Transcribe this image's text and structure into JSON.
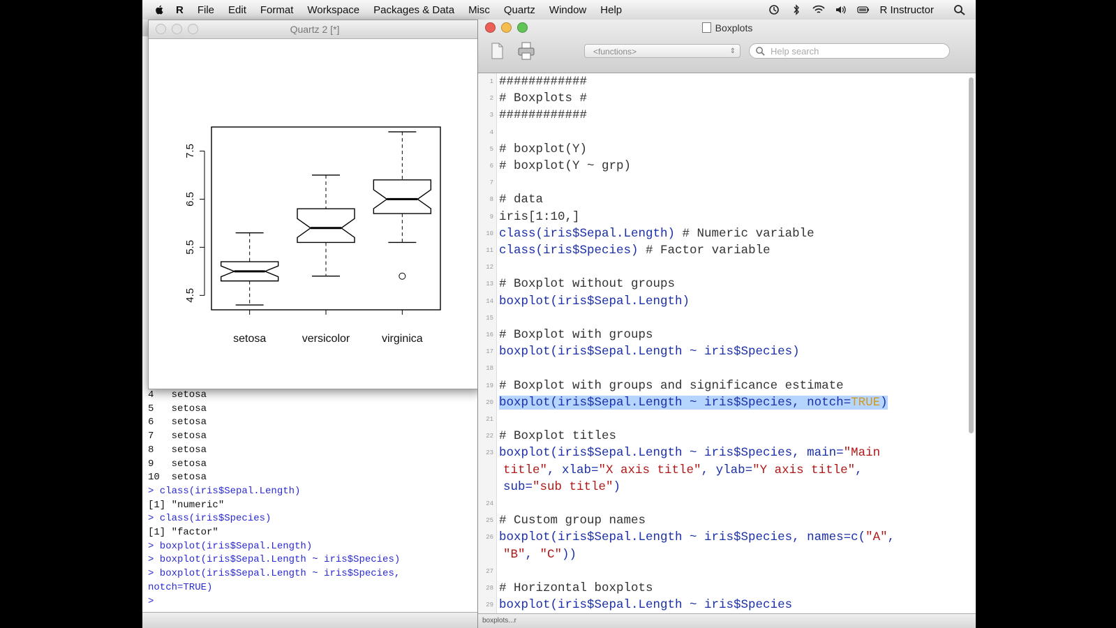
{
  "menubar": {
    "items": [
      "R",
      "File",
      "Edit",
      "Format",
      "Workspace",
      "Packages & Data",
      "Misc",
      "Quartz",
      "Window",
      "Help"
    ],
    "user": "R Instructor",
    "status_icons": [
      "time-machine-icon",
      "bluetooth-icon",
      "wifi-icon",
      "volume-icon",
      "battery-icon"
    ]
  },
  "console": {
    "lines": [
      {
        "text": "4   setosa",
        "type": "out"
      },
      {
        "text": "5   setosa",
        "type": "out"
      },
      {
        "text": "6   setosa",
        "type": "out"
      },
      {
        "text": "7   setosa",
        "type": "out"
      },
      {
        "text": "8   setosa",
        "type": "out"
      },
      {
        "text": "9   setosa",
        "type": "out"
      },
      {
        "text": "10  setosa",
        "type": "out"
      },
      {
        "text": "> class(iris$Sepal.Length)",
        "type": "in"
      },
      {
        "text": "[1] \"numeric\"",
        "type": "out"
      },
      {
        "text": "> class(iris$Species)",
        "type": "in"
      },
      {
        "text": "[1] \"factor\"",
        "type": "out"
      },
      {
        "text": "> boxplot(iris$Sepal.Length)",
        "type": "in"
      },
      {
        "text": "> boxplot(iris$Sepal.Length ~ iris$Species)",
        "type": "in"
      },
      {
        "text": "> boxplot(iris$Sepal.Length ~ iris$Species,",
        "type": "in"
      },
      {
        "text": "notch=TRUE)",
        "type": "in"
      },
      {
        "text": ">",
        "type": "in"
      }
    ]
  },
  "quartz": {
    "title": "Quartz 2 [*]"
  },
  "chart_data": {
    "type": "boxplot",
    "notch": true,
    "categories": [
      "setosa",
      "versicolor",
      "virginica"
    ],
    "boxes": [
      {
        "name": "setosa",
        "whisker_low": 4.3,
        "q1": 4.8,
        "median": 5.0,
        "q3": 5.2,
        "whisker_high": 5.8,
        "outliers": []
      },
      {
        "name": "versicolor",
        "whisker_low": 4.9,
        "q1": 5.6,
        "median": 5.9,
        "q3": 6.3,
        "whisker_high": 7.0,
        "outliers": []
      },
      {
        "name": "virginica",
        "whisker_low": 5.6,
        "q1": 6.2,
        "median": 6.5,
        "q3": 6.9,
        "whisker_high": 7.9,
        "outliers": [
          4.9
        ]
      }
    ],
    "y_ticks": [
      "4.5",
      "5.5",
      "6.5",
      "7.5"
    ],
    "y_tick_values": [
      4.5,
      5.5,
      6.5,
      7.5
    ],
    "ylim": [
      4.2,
      8.0
    ]
  },
  "editor": {
    "title": "Boxplots",
    "functions_placeholder": "<functions>",
    "help_placeholder": "Help search",
    "status": "boxplots...r",
    "lines": [
      {
        "n": "1",
        "parts": [
          {
            "t": "############",
            "c": "cm"
          }
        ]
      },
      {
        "n": "2",
        "parts": [
          {
            "t": "# Boxplots #",
            "c": "cm"
          }
        ]
      },
      {
        "n": "3",
        "parts": [
          {
            "t": "############",
            "c": "cm"
          }
        ]
      },
      {
        "n": "4",
        "parts": []
      },
      {
        "n": "5",
        "parts": [
          {
            "t": "# boxplot(Y)",
            "c": "cm"
          }
        ]
      },
      {
        "n": "6",
        "parts": [
          {
            "t": "# boxplot(Y ~ grp)",
            "c": "cm"
          }
        ]
      },
      {
        "n": "7",
        "parts": []
      },
      {
        "n": "8",
        "parts": [
          {
            "t": "# data",
            "c": "cm"
          }
        ]
      },
      {
        "n": "9",
        "parts": [
          {
            "t": "iris[1:10,]",
            "c": "cm"
          }
        ]
      },
      {
        "n": "10",
        "parts": [
          {
            "t": "class(iris$Sepal.Length)",
            "c": "fn"
          },
          {
            "t": " # Numeric variable",
            "c": "cm"
          }
        ]
      },
      {
        "n": "11",
        "parts": [
          {
            "t": "class(iris$Species)",
            "c": "fn"
          },
          {
            "t": " # Factor variable",
            "c": "cm"
          }
        ]
      },
      {
        "n": "12",
        "parts": []
      },
      {
        "n": "13",
        "parts": [
          {
            "t": "# Boxplot without groups",
            "c": "cm"
          }
        ]
      },
      {
        "n": "14",
        "parts": [
          {
            "t": "boxplot(iris$Sepal.Length)",
            "c": "fn"
          }
        ]
      },
      {
        "n": "15",
        "parts": []
      },
      {
        "n": "16",
        "parts": [
          {
            "t": "# Boxplot with groups",
            "c": "cm"
          }
        ]
      },
      {
        "n": "17",
        "parts": [
          {
            "t": "boxplot(iris$Sepal.Length ~ iris$Species)",
            "c": "fn"
          }
        ]
      },
      {
        "n": "18",
        "parts": []
      },
      {
        "n": "19",
        "parts": [
          {
            "t": "# Boxplot with groups and significance estimate",
            "c": "cm"
          }
        ]
      },
      {
        "n": "20",
        "sel": true,
        "parts": [
          {
            "t": "boxplot(iris$Sepal.Length ~ iris$Species, notch=",
            "c": "fn"
          },
          {
            "t": "TRUE",
            "c": "kw"
          },
          {
            "t": ")",
            "c": "fn"
          }
        ]
      },
      {
        "n": "21",
        "parts": []
      },
      {
        "n": "22",
        "parts": [
          {
            "t": "# Boxplot titles",
            "c": "cm"
          }
        ]
      },
      {
        "n": "23",
        "parts": [
          {
            "t": "boxplot(iris$Sepal.Length ~ iris$Species, main=",
            "c": "fn"
          },
          {
            "t": "\"Main",
            "c": "str"
          }
        ]
      },
      {
        "n": "",
        "parts": [
          {
            "t": "title\"",
            "c": "str"
          },
          {
            "t": ", xlab=",
            "c": "fn"
          },
          {
            "t": "\"X axis title\"",
            "c": "str"
          },
          {
            "t": ", ylab=",
            "c": "fn"
          },
          {
            "t": "\"Y axis title\"",
            "c": "str"
          },
          {
            "t": ",",
            "c": "fn"
          }
        ]
      },
      {
        "n": "",
        "parts": [
          {
            "t": "sub=",
            "c": "fn"
          },
          {
            "t": "\"sub title\"",
            "c": "str"
          },
          {
            "t": ")",
            "c": "fn"
          }
        ]
      },
      {
        "n": "24",
        "parts": []
      },
      {
        "n": "25",
        "parts": [
          {
            "t": "# Custom group names",
            "c": "cm"
          }
        ]
      },
      {
        "n": "26",
        "parts": [
          {
            "t": "boxplot(iris$Sepal.Length ~ iris$Species, names=c(",
            "c": "fn"
          },
          {
            "t": "\"A\"",
            "c": "str"
          },
          {
            "t": ",",
            "c": "fn"
          }
        ]
      },
      {
        "n": "",
        "parts": [
          {
            "t": "\"B\"",
            "c": "str"
          },
          {
            "t": ", ",
            "c": "fn"
          },
          {
            "t": "\"C\"",
            "c": "str"
          },
          {
            "t": "))",
            "c": "fn"
          }
        ]
      },
      {
        "n": "27",
        "parts": []
      },
      {
        "n": "28",
        "parts": [
          {
            "t": "# Horizontal boxplots",
            "c": "cm"
          }
        ]
      },
      {
        "n": "29",
        "parts": [
          {
            "t": "boxplot(iris$Sepal.Length ~ iris$Species",
            "c": "fn"
          }
        ]
      }
    ]
  },
  "colors": {
    "fn": "#1a2fa8",
    "str": "#b01818",
    "kw": "#d09a20",
    "selection": "#b5d5ff"
  }
}
